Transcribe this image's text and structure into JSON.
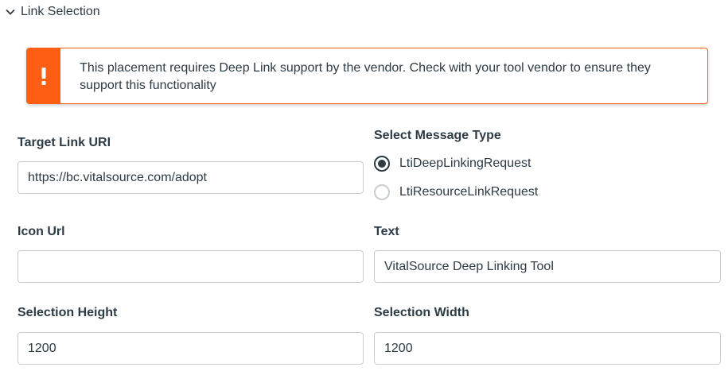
{
  "section": {
    "title": "Link Selection"
  },
  "alert": {
    "message": "This placement requires Deep Link support by the vendor. Check with your tool vendor to ensure they support this functionality",
    "icon": "exclamation-icon",
    "color": "#fc5e13"
  },
  "fields": {
    "target_link_uri": {
      "label": "Target Link URI",
      "value": "https://bc.vitalsource.com/adopt"
    },
    "icon_url": {
      "label": "Icon Url",
      "value": ""
    },
    "text": {
      "label": "Text",
      "value": "VitalSource Deep Linking Tool"
    },
    "selection_height": {
      "label": "Selection Height",
      "value": "1200"
    },
    "selection_width": {
      "label": "Selection Width",
      "value": "1200"
    }
  },
  "message_type": {
    "label": "Select Message Type",
    "options": [
      {
        "label": "LtiDeepLinkingRequest",
        "selected": true
      },
      {
        "label": "LtiResourceLinkRequest",
        "selected": false
      }
    ]
  }
}
